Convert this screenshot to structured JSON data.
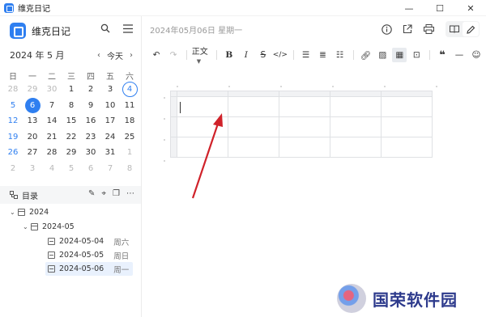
{
  "window": {
    "title": "维克日记",
    "controls": [
      "minimize",
      "maximize",
      "close"
    ]
  },
  "sidebar": {
    "brand": "维克日记",
    "calendar": {
      "month_label": "2024 年 5 月",
      "today_label": "今天",
      "weekdays": [
        "日",
        "一",
        "二",
        "三",
        "四",
        "五",
        "六"
      ],
      "weeks": [
        [
          "28",
          "29",
          "30",
          "1",
          "2",
          "3",
          "4"
        ],
        [
          "5",
          "6",
          "7",
          "8",
          "9",
          "10",
          "11"
        ],
        [
          "12",
          "13",
          "14",
          "15",
          "16",
          "17",
          "18"
        ],
        [
          "19",
          "20",
          "21",
          "22",
          "23",
          "24",
          "25"
        ],
        [
          "26",
          "27",
          "28",
          "29",
          "30",
          "31",
          "1"
        ],
        [
          "2",
          "3",
          "4",
          "5",
          "6",
          "7",
          "8"
        ]
      ],
      "selected_day": "6",
      "marked_day": "4"
    },
    "directory": {
      "label": "目录",
      "tree": [
        {
          "label": "2024",
          "type": "year"
        },
        {
          "label": "2024-05",
          "type": "month"
        },
        {
          "label": "2024-05-04",
          "weekday": "周六"
        },
        {
          "label": "2024-05-05",
          "weekday": "周日"
        },
        {
          "label": "2024-05-06",
          "weekday": "周一",
          "active": true
        }
      ]
    }
  },
  "main": {
    "date_title": "2024年05月06日 星期一",
    "toolbar": {
      "style_label": "正文"
    },
    "table": {
      "rows": 3,
      "cols": 5
    }
  },
  "watermark": "国荣软件园",
  "colors": {
    "accent": "#2f7ff0",
    "arrow": "#d0222a"
  }
}
